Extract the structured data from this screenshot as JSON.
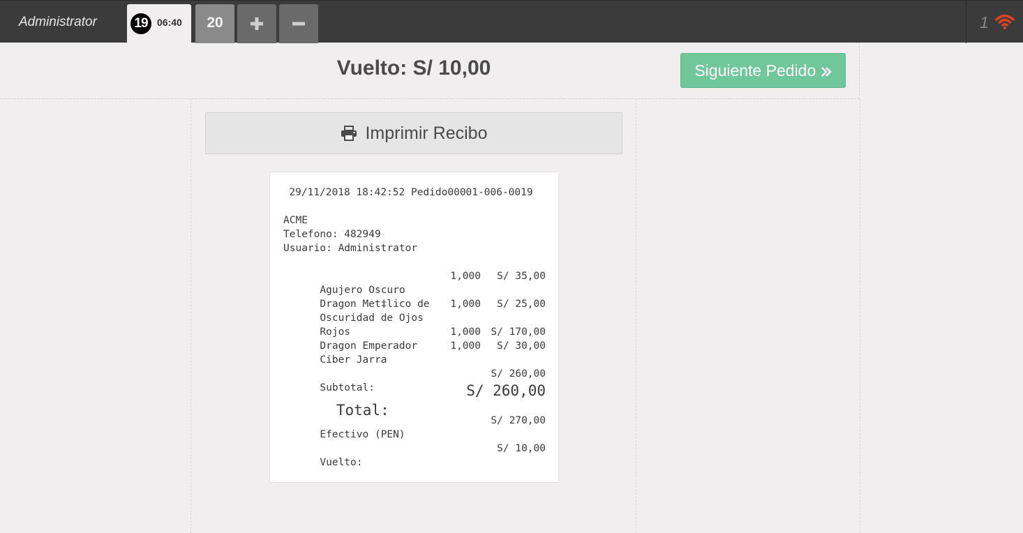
{
  "topbar": {
    "user_name": "Administrator",
    "active_order": {
      "number": "19",
      "time": "06:40"
    },
    "next_order_number": "20",
    "add_icon": "plus-icon",
    "remove_icon": "minus-icon",
    "connection_count": "1",
    "connection_icon": "wifi-icon",
    "connection_color": "#d9451f"
  },
  "header": {
    "change_title": "Vuelto: S/ 10,00",
    "next_order_label": "Siguiente Pedido",
    "next_order_icon": "double-chevron-right-icon",
    "accent_color": "#6fc79a"
  },
  "print_button": {
    "label": "Imprimir Recibo",
    "icon": "print-icon"
  },
  "receipt": {
    "header_line": "29/11/2018 18:42:52 Pedido00001-006-0019",
    "company": "ACME",
    "phone": "Telefono: 482949",
    "user": "Usuario: Administrator",
    "items": [
      {
        "name": "Agujero Oscuro",
        "qty": "1,000",
        "price": "S/ 35,00"
      },
      {
        "name_line1": "Dragon Met‡lico de",
        "name_line2": "Oscuridad de Ojos",
        "name_line3": "Rojos",
        "qty": "1,000",
        "price": "S/ 25,00"
      },
      {
        "name": "Dragon Emperador",
        "qty": "1,000",
        "price": "S/ 170,00"
      },
      {
        "name": "Ciber Jarra",
        "qty": "1,000",
        "price": "S/ 30,00"
      }
    ],
    "subtotal_label": "Subtotal:",
    "subtotal_value": "S/ 260,00",
    "total_label": "Total:",
    "total_value": "S/ 260,00",
    "payment_label": "Efectivo (PEN)",
    "payment_value": "S/ 270,00",
    "change_label": "Vuelto:",
    "change_value": "S/ 10,00"
  }
}
